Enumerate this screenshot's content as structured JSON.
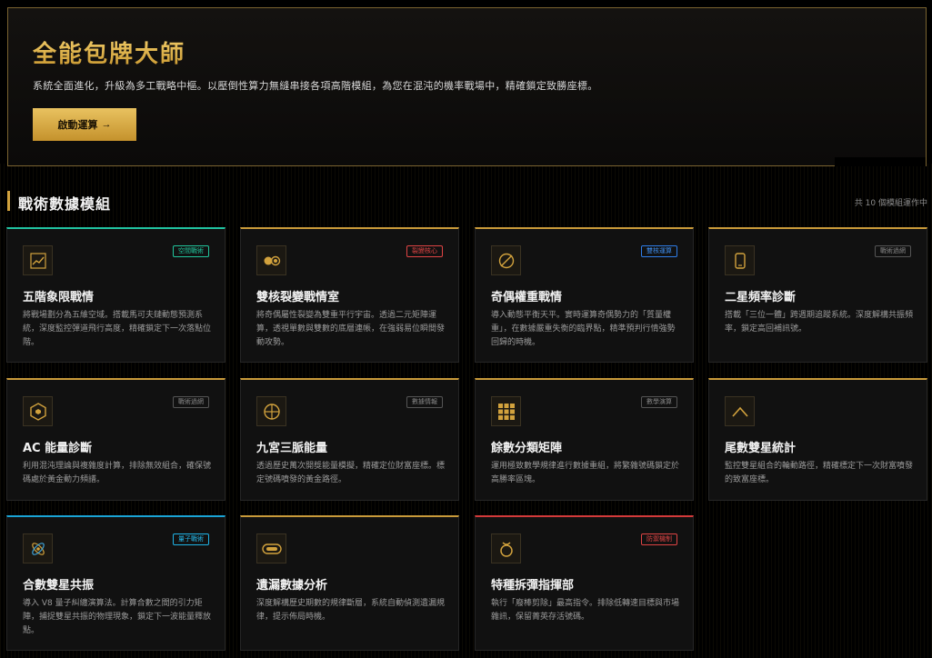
{
  "hero": {
    "title": "全能包牌大師",
    "description": "系統全面進化，升級為多工戰略中樞。以壓倒性算力無縫串接各項高階模組，為您在混沌的機率戰場中，精確鎖定致勝座標。",
    "button_label": "啟動運算",
    "button_arrow": "→"
  },
  "section": {
    "title": "戰術數據模組",
    "count_text": "共 10 個模組運作中"
  },
  "colors": {
    "gold": "#d2a23d",
    "teal": "#20c3a0",
    "cyan": "#1aa4d6",
    "red": "#d33a3a",
    "blue": "#2f7de8"
  },
  "modules": [
    {
      "title": "五階象限戰情",
      "badge": "空間戰術",
      "badge_color": "teal",
      "icon": "trend-chart-icon",
      "description": "將戰場劃分為五維空域。搭載馬可夫鏈動態預測系統，深度監控彈道飛行高度，精確鎖定下一次落點位階。"
    },
    {
      "title": "雙核裂變戰情室",
      "badge": "裂變核心",
      "badge_color": "red",
      "icon": "dual-core-icon",
      "description": "將奇偶屬性裂變為雙重平行宇宙。透過二元矩陣運算，透視單數與雙數的底層連帳，在強弱易位瞬間發動攻勢。"
    },
    {
      "title": "奇偶權重戰情",
      "badge": "雙核運算",
      "badge_color": "blue",
      "icon": "balance-icon",
      "description": "導入動態平衡天平。實時運算奇偶勢力的「質量權重」，在數據嚴重失衡的臨界點，精準預判行情強勢回歸的時機。"
    },
    {
      "title": "二星頻率診斷",
      "badge": "戰術過網",
      "badge_color": "gray",
      "icon": "phone-icon",
      "description": "搭載「三位一體」跨週期追蹤系統。深度解構共振頻率，鎖定高回補訊號。"
    },
    {
      "title": "AC 能量診斷",
      "badge": "戰術過網",
      "badge_color": "gray",
      "icon": "hexagon-icon",
      "description": "利用混沌理論與複雜度計算，排除無效組合，確保號碼處於黃金動力頻譜。"
    },
    {
      "title": "九宮三脈能量",
      "badge": "數據情報",
      "badge_color": "gray",
      "icon": "crosshair-icon",
      "description": "透過歷史萬次開獎能量模擬，精確定位財富座標。標定號碼噴發的黃金路徑。"
    },
    {
      "title": "餘數分類矩陣",
      "badge": "數學演算",
      "badge_color": "gray",
      "icon": "grid-icon",
      "description": "運用極致數學規律進行數據重組，將繁雜號碼鎖定於高勝率區塊。"
    },
    {
      "title": "尾數雙星統計",
      "badge": "",
      "badge_color": "gray",
      "icon": "caret-up-icon",
      "description": "監控雙星組合的輪動路徑，精確標定下一次財富噴發的致富座標。"
    },
    {
      "title": "合數雙星共振",
      "badge": "量子戰術",
      "badge_color": "cyan",
      "icon": "atom-icon",
      "description": "導入 V8 量子糾纏演算法。計算合數之間的引力矩陣，捕捉雙星共振的物理現象，鎖定下一波能量釋放點。"
    },
    {
      "title": "遺漏數據分析",
      "badge": "",
      "badge_color": "gray",
      "icon": "toggle-icon",
      "description": "深度解構歷史期數的規律斷層，系統自動偵測遺漏規律，提示佈局時機。"
    },
    {
      "title": "特種拆彈指揮部",
      "badge": "防禦機制",
      "badge_color": "red",
      "icon": "bomb-icon",
      "description": "執行「廢棒剪除」最高指令。排除低轉速目標與市場雜訊，保留菁英存活號碼。"
    }
  ]
}
